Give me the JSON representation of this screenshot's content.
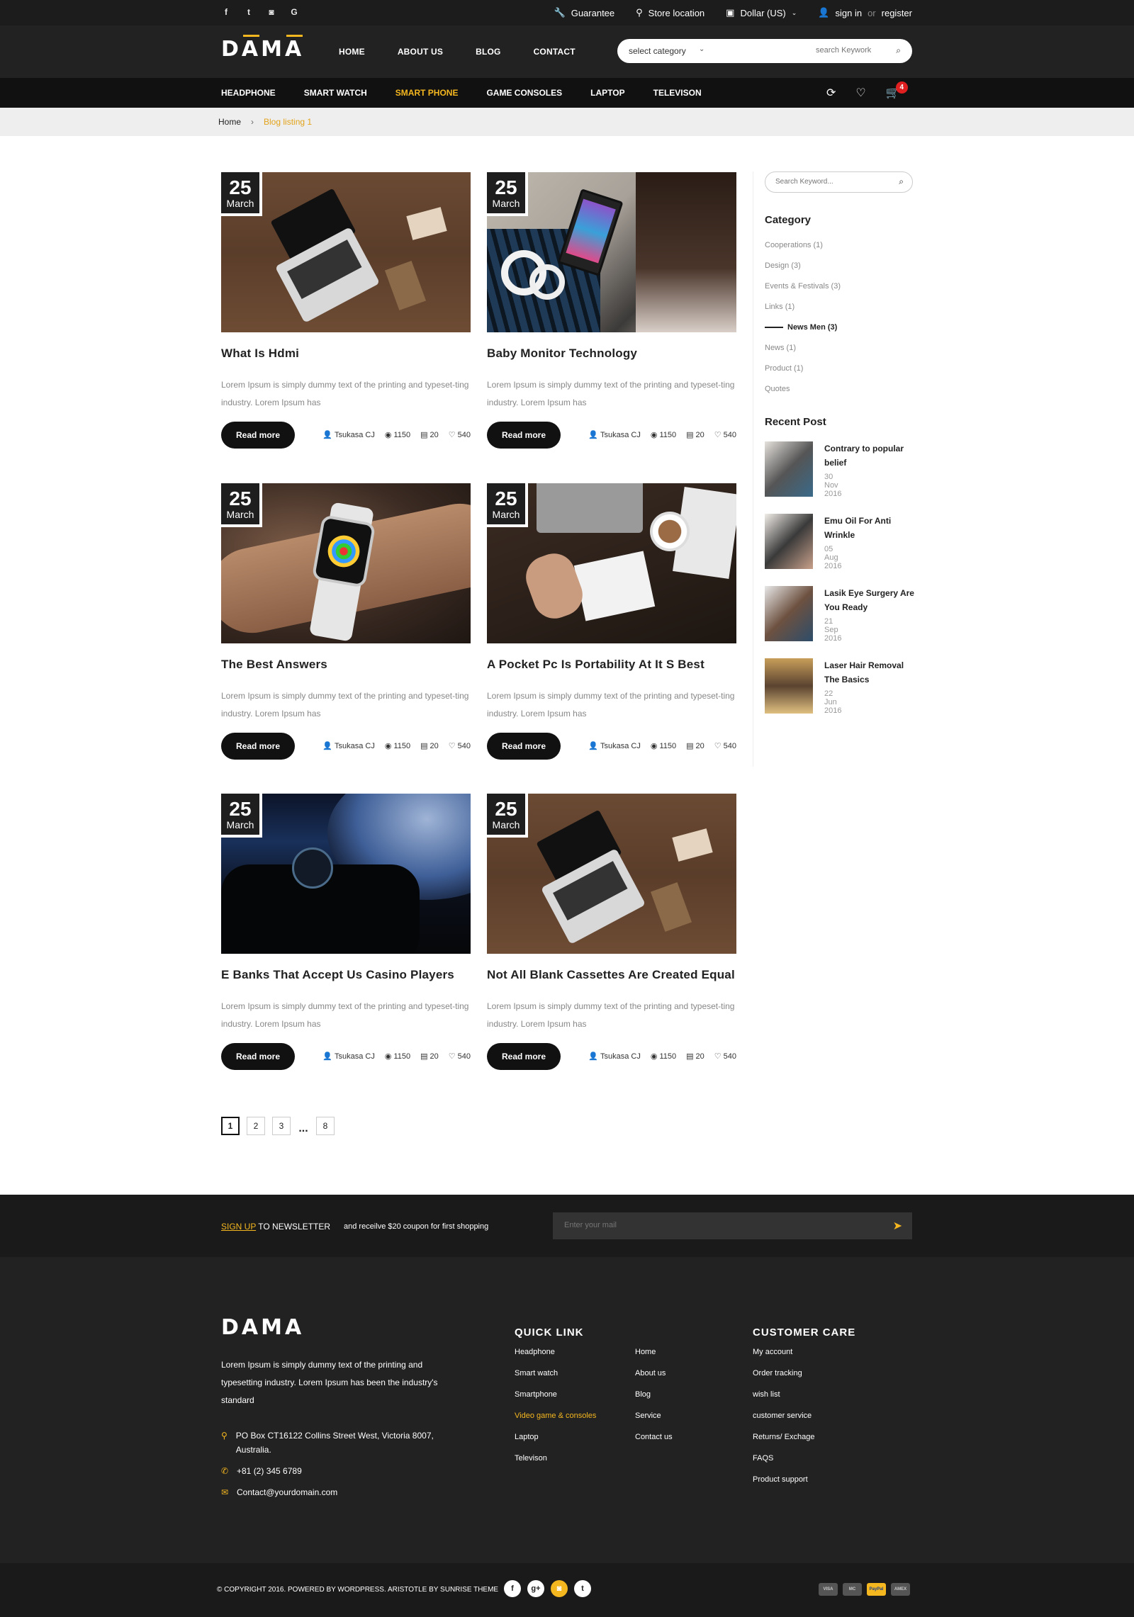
{
  "topbar": {
    "social": [
      {
        "icon": "facebook-icon",
        "glyph": "f"
      },
      {
        "icon": "twitter-icon",
        "glyph": "t"
      },
      {
        "icon": "instagram-icon",
        "glyph": "◙"
      },
      {
        "icon": "google-icon",
        "glyph": "G"
      }
    ],
    "guarantee": "Guarantee",
    "store_location": "Store location",
    "currency": "Dollar (US)",
    "sign_in": "sign in",
    "or": "or",
    "register": "register"
  },
  "header": {
    "logo": "DAMA",
    "nav": [
      "HOME",
      "ABOUT US",
      "BLOG",
      "CONTACT"
    ],
    "search": {
      "category": "select category",
      "placeholder": "search Keywork"
    }
  },
  "categories": {
    "items": [
      "HEADPHONE",
      "SMART WATCH",
      "SMART PHONE",
      "GAME CONSOLES",
      "LAPTOP",
      "TELEVISON"
    ],
    "active_index": 2,
    "cart_count": "4"
  },
  "breadcrumb": {
    "home": "Home",
    "sep": "›",
    "current": "Blog listing 1"
  },
  "posts": [
    {
      "day": "25",
      "month": "March",
      "title": "What Is Hdmi",
      "excerpt": "Lorem Ipsum is simply dummy text of the printing and typeset-ting industry. Lorem Ipsum has",
      "read_more": "Read more",
      "author": "Tsukasa CJ",
      "views": "1150",
      "comments": "20",
      "likes": "540",
      "image": "laptop-on-wood"
    },
    {
      "day": "25",
      "month": "March",
      "title": "Baby Monitor Technology",
      "excerpt": "Lorem Ipsum is simply dummy text of the printing and typeset-ting industry. Lorem Ipsum has",
      "read_more": "Read more",
      "author": "Tsukasa CJ",
      "views": "1150",
      "comments": "20",
      "likes": "540",
      "image": "phone-headphones"
    },
    {
      "day": "25",
      "month": "March",
      "title": "The Best Answers",
      "excerpt": "Lorem Ipsum is simply dummy text of the printing and typeset-ting industry. Lorem Ipsum has",
      "read_more": "Read more",
      "author": "Tsukasa CJ",
      "views": "1150",
      "comments": "20",
      "likes": "540",
      "image": "smartwatch-wrist"
    },
    {
      "day": "25",
      "month": "March",
      "title": "A Pocket Pc Is Portability At It S Best",
      "excerpt": "Lorem Ipsum is simply dummy text of the printing and typeset-ting industry. Lorem Ipsum has",
      "read_more": "Read more",
      "author": "Tsukasa CJ",
      "views": "1150",
      "comments": "20",
      "likes": "540",
      "image": "desk-coffee"
    },
    {
      "day": "25",
      "month": "March",
      "title": "E Banks That Accept Us Casino Players",
      "excerpt": "Lorem Ipsum is simply dummy text of the printing and typeset-ting industry. Lorem Ipsum has",
      "read_more": "Read more",
      "author": "Tsukasa CJ",
      "views": "1150",
      "comments": "20",
      "likes": "540",
      "image": "watch-airplane-window"
    },
    {
      "day": "25",
      "month": "March",
      "title": "Not All Blank Cassettes Are Created Equal",
      "excerpt": "Lorem Ipsum is simply dummy text of the printing and typeset-ting industry. Lorem Ipsum has",
      "read_more": "Read more",
      "author": "Tsukasa CJ",
      "views": "1150",
      "comments": "20",
      "likes": "540",
      "image": "laptop-on-wood"
    }
  ],
  "pagination": {
    "pages": [
      "1",
      "2",
      "3"
    ],
    "dots": "...",
    "last": "8",
    "active": "1"
  },
  "sidebar": {
    "search_placeholder": "Search Keyword...",
    "category_title": "Category",
    "categories": [
      "Cooperations (1)",
      "Design (3)",
      "Events & Festivals (3)",
      "Links (1)",
      "News Men (3)",
      "News (1)",
      "Product (1)",
      "Quotes"
    ],
    "active_category": 4,
    "recent_title": "Recent Post",
    "recent": [
      {
        "title": "Contrary to popular belief",
        "date": "30 Nov 2016"
      },
      {
        "title": "Emu Oil For Anti Wrinkle",
        "date": "05 Aug 2016"
      },
      {
        "title": "Lasik Eye Surgery Are You Ready",
        "date": "21 Sep 2016"
      },
      {
        "title": "Laser Hair Removal The Basics",
        "date": "22 Jun 2016"
      }
    ]
  },
  "newsletter": {
    "sign_up": "SIGN UP",
    "to_newsletter": "TO NEWSLETTER",
    "offer": "and receilve $20 coupon for first shopping",
    "placeholder": "Enter your mail"
  },
  "footer": {
    "logo": "DAMA",
    "description": "Lorem Ipsum is simply dummy text of the printing and typesetting industry. Lorem Ipsum has been the industry's standard",
    "address": "PO Box CT16122 Collins Street West, Victoria 8007, Australia.",
    "phone": "+81 (2) 345 6789",
    "email": "Contact@yourdomain.com",
    "quick_link_title": "QUICK LINK",
    "quick_links_a": [
      "Headphone",
      "Smart watch",
      "Smartphone",
      "Video game & consoles",
      "Laptop",
      "Televison"
    ],
    "quick_links_b": [
      "Home",
      "About us",
      "Blog",
      "Service",
      "Contact us"
    ],
    "customer_care_title": "CUSTOMER CARE",
    "customer_care": [
      "My account",
      "Order tracking",
      "wish list",
      "customer service",
      "Returns/ Exchage",
      "FAQS",
      "Product support"
    ]
  },
  "bottom": {
    "copyright": "© COPYRIGHT 2016. POWERED BY WORDPRESS. ARISTOTLE  BY SUNRISE THEME",
    "social": [
      "f",
      "g+",
      "◙",
      "t"
    ],
    "payments": [
      "VISA",
      "MC",
      "PayPal",
      "AMEX"
    ]
  },
  "colors": {
    "accent": "#f5b71f",
    "dark": "#222222",
    "badge": "#e02020"
  }
}
